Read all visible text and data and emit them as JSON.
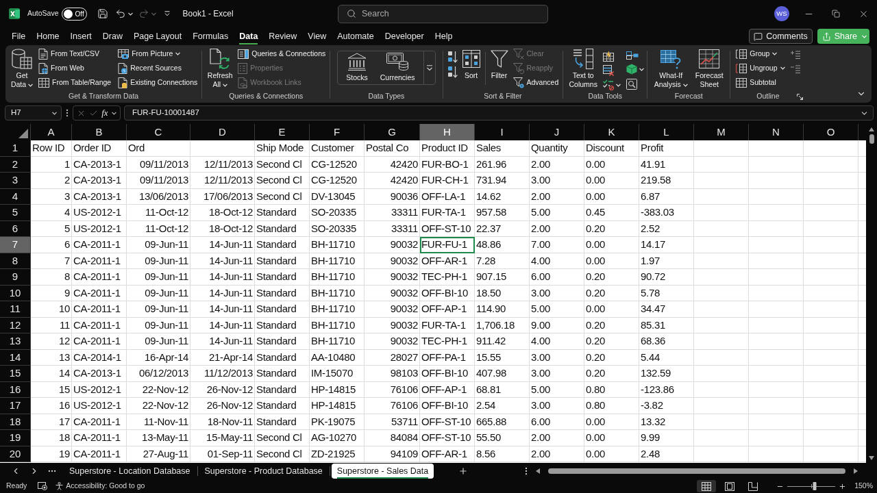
{
  "title_bar": {
    "autosave": {
      "label": "AutoSave",
      "on": false,
      "state": "Off"
    },
    "title": "Book1 - Excel",
    "search": {
      "placeholder": "Search"
    },
    "account": "WS"
  },
  "menu": {
    "tabs": [
      {
        "label": "File",
        "selected": false
      },
      {
        "label": "Home",
        "selected": false
      },
      {
        "label": "Insert",
        "selected": false
      },
      {
        "label": "Draw",
        "selected": false
      },
      {
        "label": "Page Layout",
        "selected": false
      },
      {
        "label": "Formulas",
        "selected": false
      },
      {
        "label": "Data",
        "selected": true
      },
      {
        "label": "Review",
        "selected": false
      },
      {
        "label": "View",
        "selected": false
      },
      {
        "label": "Automate",
        "selected": false
      },
      {
        "label": "Developer",
        "selected": false
      },
      {
        "label": "Help",
        "selected": false
      }
    ],
    "buttons": [
      {
        "label": "Comments",
        "kind": "outline"
      },
      {
        "label": "Share",
        "kind": "primary"
      }
    ]
  },
  "ribbon": {
    "groups": [
      {
        "label": "Get & Transform Data",
        "items": [
          {
            "label": "Get Data",
            "dropdown": true
          },
          {
            "label": "From Text/CSV",
            "dropdown": false
          },
          {
            "label": "From Web",
            "dropdown": false
          },
          {
            "label": "From Table/Range",
            "dropdown": false
          },
          {
            "label": "From Picture",
            "dropdown": true
          },
          {
            "label": "Recent Sources",
            "dropdown": false
          },
          {
            "label": "Existing Connections",
            "dropdown": false
          }
        ]
      },
      {
        "label": "Queries & Connections",
        "items": [
          {
            "label": "Refresh All",
            "dropdown": true,
            "disabled": false
          },
          {
            "label": "Queries & Connections",
            "dropdown": false,
            "disabled": false
          },
          {
            "label": "Properties",
            "dropdown": false,
            "disabled": true
          },
          {
            "label": "Workbook Links",
            "dropdown": false,
            "disabled": true
          }
        ]
      },
      {
        "label": "Data Types",
        "items": [
          {
            "label": "Stocks"
          },
          {
            "label": "Currencies"
          }
        ]
      },
      {
        "label": "Sort & Filter",
        "items": [
          {
            "label": "Sort",
            "dropdown": false,
            "disabled": false
          },
          {
            "label": "Filter",
            "dropdown": false,
            "disabled": false
          },
          {
            "label": "Clear",
            "dropdown": false,
            "disabled": true
          },
          {
            "label": "Reapply",
            "dropdown": false,
            "disabled": true
          },
          {
            "label": "Advanced",
            "dropdown": false,
            "disabled": false
          }
        ]
      },
      {
        "label": "Data Tools",
        "items": [
          {
            "label": "Text to Columns",
            "dropdown": false
          }
        ]
      },
      {
        "label": "Forecast",
        "items": [
          {
            "label": "What-If Analysis",
            "dropdown": true
          },
          {
            "label": "Forecast Sheet",
            "dropdown": false
          }
        ]
      },
      {
        "label": "Outline",
        "items": [
          {
            "label": "Group",
            "dropdown": true
          },
          {
            "label": "Ungroup",
            "dropdown": true
          },
          {
            "label": "Subtotal",
            "dropdown": false
          }
        ]
      }
    ]
  },
  "formula_bar": {
    "name_box": "H7",
    "function_button": "fx",
    "formula": "FUR-FU-10001487"
  },
  "sheet": {
    "columns": [
      {
        "label": "A",
        "selected": false
      },
      {
        "label": "B",
        "selected": false
      },
      {
        "label": "C",
        "selected": false
      },
      {
        "label": "D",
        "selected": false
      },
      {
        "label": "E",
        "selected": false
      },
      {
        "label": "F",
        "selected": false
      },
      {
        "label": "G",
        "selected": false
      },
      {
        "label": "H",
        "selected": true
      },
      {
        "label": "I",
        "selected": false
      },
      {
        "label": "J",
        "selected": false
      },
      {
        "label": "K",
        "selected": false
      },
      {
        "label": "L",
        "selected": false
      },
      {
        "label": "M",
        "selected": false
      },
      {
        "label": "N",
        "selected": false
      },
      {
        "label": "O",
        "selected": false
      }
    ],
    "rows": [
      {
        "label": "1",
        "kind": "header",
        "selected": false,
        "cells": [
          "Row ID",
          "Order ID",
          "Ord",
          null,
          "Ship Mode",
          "Customer",
          "Postal Co",
          "Product ID",
          "Sales",
          "Quantity",
          "Discount",
          "Profit"
        ]
      },
      {
        "label": "2",
        "kind": "record",
        "selected": false,
        "cells": [
          "1",
          "CA-2013-1",
          "09/11/2013",
          "12/11/2013",
          "Second Cl",
          "CG-12520",
          "42420",
          "FUR-BO-1",
          "261.96",
          "2.00",
          "0.00",
          "41.91"
        ]
      },
      {
        "label": "3",
        "kind": "record",
        "selected": false,
        "cells": [
          "2",
          "CA-2013-1",
          "09/11/2013",
          "12/11/2013",
          "Second Cl",
          "CG-12520",
          "42420",
          "FUR-CH-1",
          "731.94",
          "3.00",
          "0.00",
          "219.58"
        ]
      },
      {
        "label": "4",
        "kind": "record",
        "selected": false,
        "cells": [
          "3",
          "CA-2013-1",
          "13/06/2013",
          "17/06/2013",
          "Second Cl",
          "DV-13045",
          "90036",
          "OFF-LA-1",
          "14.62",
          "2.00",
          "0.00",
          "6.87"
        ]
      },
      {
        "label": "5",
        "kind": "record",
        "selected": false,
        "cells": [
          "4",
          "US-2012-1",
          "11-Oct-12",
          "18-Oct-12",
          "Standard",
          "SO-20335",
          "33311",
          "FUR-TA-1",
          "957.58",
          "5.00",
          "0.45",
          "-383.03"
        ]
      },
      {
        "label": "6",
        "kind": "record",
        "selected": false,
        "cells": [
          "5",
          "US-2012-1",
          "11-Oct-12",
          "18-Oct-12",
          "Standard",
          "SO-20335",
          "33311",
          "OFF-ST-10",
          "22.37",
          "2.00",
          "0.20",
          "2.52"
        ]
      },
      {
        "label": "7",
        "kind": "record",
        "selected": true,
        "cells": [
          "6",
          "CA-2011-1",
          "09-Jun-11",
          "14-Jun-11",
          "Standard",
          "BH-11710",
          "90032",
          "FUR-FU-1",
          "48.86",
          "7.00",
          "0.00",
          "14.17"
        ]
      },
      {
        "label": "8",
        "kind": "record",
        "selected": false,
        "cells": [
          "7",
          "CA-2011-1",
          "09-Jun-11",
          "14-Jun-11",
          "Standard",
          "BH-11710",
          "90032",
          "OFF-AR-1",
          "7.28",
          "4.00",
          "0.00",
          "1.97"
        ]
      },
      {
        "label": "9",
        "kind": "record",
        "selected": false,
        "cells": [
          "8",
          "CA-2011-1",
          "09-Jun-11",
          "14-Jun-11",
          "Standard",
          "BH-11710",
          "90032",
          "TEC-PH-1",
          "907.15",
          "6.00",
          "0.20",
          "90.72"
        ]
      },
      {
        "label": "10",
        "kind": "record",
        "selected": false,
        "cells": [
          "9",
          "CA-2011-1",
          "09-Jun-11",
          "14-Jun-11",
          "Standard",
          "BH-11710",
          "90032",
          "OFF-BI-10",
          "18.50",
          "3.00",
          "0.20",
          "5.78"
        ]
      },
      {
        "label": "11",
        "kind": "record",
        "selected": false,
        "cells": [
          "10",
          "CA-2011-1",
          "09-Jun-11",
          "14-Jun-11",
          "Standard",
          "BH-11710",
          "90032",
          "OFF-AP-1",
          "114.90",
          "5.00",
          "0.00",
          "34.47"
        ]
      },
      {
        "label": "12",
        "kind": "record",
        "selected": false,
        "cells": [
          "11",
          "CA-2011-1",
          "09-Jun-11",
          "14-Jun-11",
          "Standard",
          "BH-11710",
          "90032",
          "FUR-TA-1",
          "1,706.18",
          "9.00",
          "0.20",
          "85.31"
        ]
      },
      {
        "label": "13",
        "kind": "record",
        "selected": false,
        "cells": [
          "12",
          "CA-2011-1",
          "09-Jun-11",
          "14-Jun-11",
          "Standard",
          "BH-11710",
          "90032",
          "TEC-PH-1",
          "911.42",
          "4.00",
          "0.20",
          "68.36"
        ]
      },
      {
        "label": "14",
        "kind": "record",
        "selected": false,
        "cells": [
          "13",
          "CA-2014-1",
          "16-Apr-14",
          "21-Apr-14",
          "Standard",
          "AA-10480",
          "28027",
          "OFF-PA-1",
          "15.55",
          "3.00",
          "0.20",
          "5.44"
        ]
      },
      {
        "label": "15",
        "kind": "record",
        "selected": false,
        "cells": [
          "14",
          "CA-2013-1",
          "06/12/2013",
          "11/12/2013",
          "Standard",
          "IM-15070",
          "98103",
          "OFF-BI-10",
          "407.98",
          "3.00",
          "0.20",
          "132.59"
        ]
      },
      {
        "label": "16",
        "kind": "record",
        "selected": false,
        "cells": [
          "15",
          "US-2012-1",
          "22-Nov-12",
          "26-Nov-12",
          "Standard",
          "HP-14815",
          "76106",
          "OFF-AP-1",
          "68.81",
          "5.00",
          "0.80",
          "-123.86"
        ]
      },
      {
        "label": "17",
        "kind": "record",
        "selected": false,
        "cells": [
          "16",
          "US-2012-1",
          "22-Nov-12",
          "26-Nov-12",
          "Standard",
          "HP-14815",
          "76106",
          "OFF-BI-10",
          "2.54",
          "3.00",
          "0.80",
          "-3.82"
        ]
      },
      {
        "label": "18",
        "kind": "record",
        "selected": false,
        "cells": [
          "17",
          "CA-2011-1",
          "11-Nov-11",
          "18-Nov-11",
          "Standard",
          "PK-19075",
          "53711",
          "OFF-ST-10",
          "665.88",
          "6.00",
          "0.00",
          "13.32"
        ]
      },
      {
        "label": "19",
        "kind": "record",
        "selected": false,
        "cells": [
          "18",
          "CA-2011-1",
          "13-May-11",
          "15-May-11",
          "Second Cl",
          "AG-10270",
          "84084",
          "OFF-ST-10",
          "55.50",
          "2.00",
          "0.00",
          "9.99"
        ]
      },
      {
        "label": "20",
        "kind": "record",
        "selected": false,
        "cells": [
          "19",
          "CA-2011-1",
          "27-Aug-11",
          "01-Sep-11",
          "Second Cl",
          "ZD-21925",
          "94109",
          "OFF-AR-1",
          "8.56",
          "2.00",
          "0.00",
          "2.48"
        ]
      }
    ]
  },
  "sheet_tabs": [
    {
      "label": "Superstore - Location Database",
      "selected": false
    },
    {
      "label": "Superstore - Product Database",
      "selected": false
    },
    {
      "label": "Superstore - Sales Data",
      "selected": true
    }
  ],
  "status_bar": {
    "status": "Ready",
    "accessibility": "Accessibility: Good to go",
    "views": [
      {
        "selected": true
      },
      {
        "selected": false
      },
      {
        "selected": false
      }
    ],
    "zoom": {
      "level": 0.57,
      "reading": "150%"
    }
  }
}
